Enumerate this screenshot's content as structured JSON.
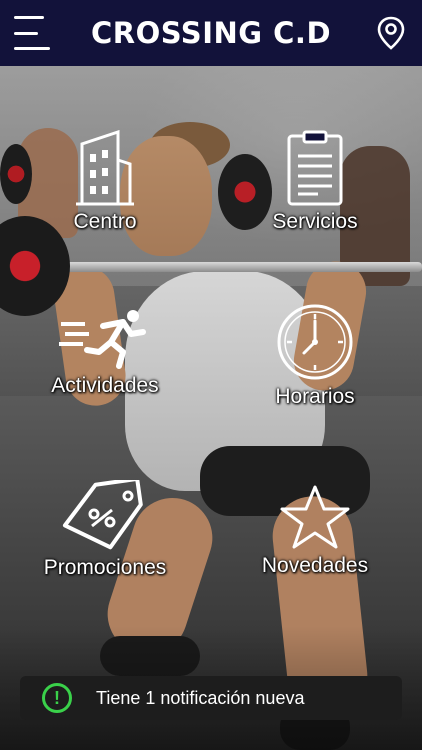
{
  "header": {
    "title": "CROSSING C.D",
    "menu_icon": "hamburger-menu-icon",
    "location_icon": "map-pin-icon",
    "background_color": "#12123a"
  },
  "menu": {
    "items": [
      {
        "label": "Centro",
        "icon": "building-icon"
      },
      {
        "label": "Servicios",
        "icon": "clipboard-list-icon"
      },
      {
        "label": "Actividades",
        "icon": "running-person-icon"
      },
      {
        "label": "Horarios",
        "icon": "clock-icon"
      },
      {
        "label": "Promociones",
        "icon": "percent-tag-icon"
      },
      {
        "label": "Novedades",
        "icon": "star-icon"
      }
    ]
  },
  "notification": {
    "text": "Tiene 1 notificación nueva",
    "icon": "alert-circle-icon",
    "icon_glyph": "!",
    "accent_color": "#3ad14a"
  }
}
